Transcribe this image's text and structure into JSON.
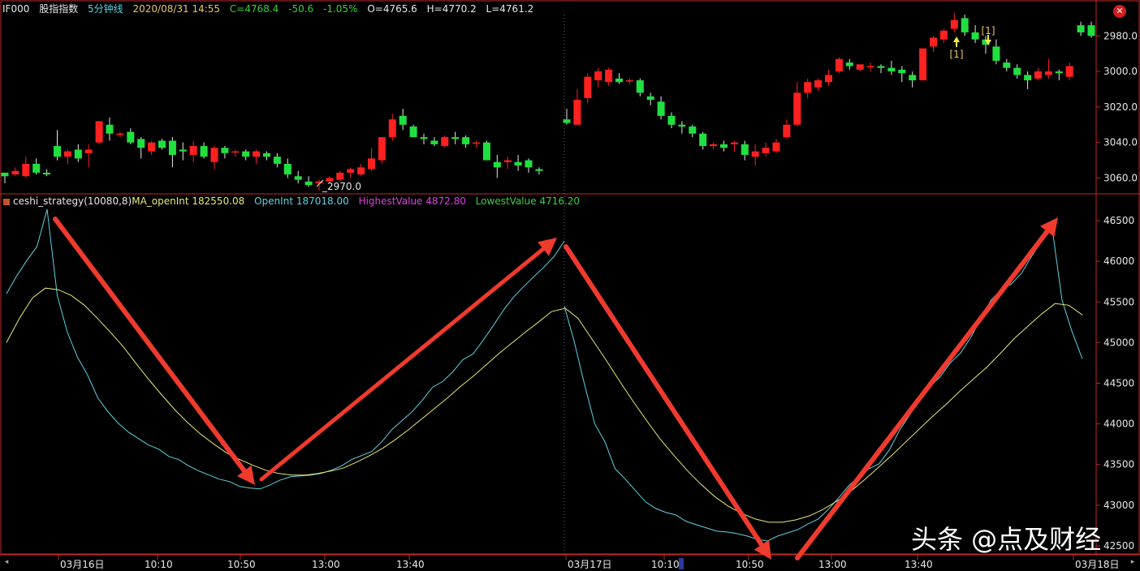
{
  "header": {
    "symbol": "IF000",
    "name": "股指指数",
    "period": "5分钟线",
    "datetime": "2020/08/31 14:55",
    "close": "C=4768.4",
    "change": "-50.6",
    "change_pct": "-1.05%",
    "open": "O=4765.6",
    "high": "H=4770.2",
    "low": "L=4761.2"
  },
  "indicator_header": {
    "name": "ceshi_strategy(10080,8)",
    "ma_label": "MA_openInt 182550.08",
    "oi_label": "OpenInt 187018.00",
    "highest_label": "HighestValue 4872.80",
    "lowest_label": "LowestValue 4716.20"
  },
  "time_axis": [
    "03月16日",
    "10:10",
    "10:50",
    "13:00",
    "13:40",
    "03月17日",
    "10:10",
    "10:50",
    "13:00",
    "13:40",
    "03月18日"
  ],
  "price_ticks": [
    "3060.0",
    "3040.0",
    "3020.0",
    "3000.0",
    "2980.0"
  ],
  "oi_ticks": [
    "46500",
    "46000",
    "45500",
    "45000",
    "44500",
    "44000",
    "43500",
    "43000",
    "42500"
  ],
  "annotations": {
    "low_label": "2970.0",
    "signal_buy": "[1]",
    "signal_sell": "[1]"
  },
  "controls": {
    "close_icon": "✕",
    "scroll_left": "◂",
    "scroll_right": "▸"
  },
  "watermark": "头条 @点及财经",
  "colors": {
    "up": "#ff2020",
    "down": "#20e040",
    "openint": "#5fd3e0",
    "ma": "#e8e878",
    "arrow": "#f03a2e",
    "grid": "#c02828",
    "header_date": "#e8c86a",
    "header_price": "#3ccf3c",
    "highest": "#e040e0",
    "lowest": "#40d040"
  },
  "chart_data": [
    {
      "type": "candlestick",
      "ylim": [
        2972,
        3072
      ],
      "y_ticks": [
        2980,
        3000,
        3020,
        3040,
        3060
      ],
      "sessions": [
        {
          "ohlc": [
            [
              2983,
              2983,
              2977,
              2981
            ],
            [
              2982,
              2986,
              2981,
              2984
            ],
            [
              2981,
              2992,
              2980,
              2988
            ],
            [
              2988,
              2991,
              2982,
              2983
            ],
            [
              2983,
              2985,
              2981,
              2982
            ],
            [
              2998,
              3007,
              2990,
              2992
            ],
            [
              2992,
              2996,
              2988,
              2995
            ],
            [
              2996,
              2999,
              2989,
              2991
            ],
            [
              2994,
              2999,
              2986,
              2996
            ],
            [
              3000,
              3012,
              2999,
              3012
            ],
            [
              3010,
              3014,
              3001,
              3005
            ],
            [
              3005,
              3006,
              3003,
              3005
            ],
            [
              3006,
              3008,
              2999,
              3000
            ],
            [
              3002,
              3003,
              2991,
              2997
            ],
            [
              2995,
              3001,
              2993,
              3000
            ],
            [
              3001,
              3002,
              2996,
              2997
            ],
            [
              3001,
              3003,
              2986,
              2993
            ],
            [
              2996,
              3000,
              2990,
              2995
            ],
            [
              2993,
              3001,
              2989,
              2998
            ],
            [
              2998,
              3000,
              2991,
              2992
            ],
            [
              2989,
              2998,
              2985,
              2997
            ],
            [
              2997,
              2998,
              2991,
              2994
            ],
            [
              2995,
              2996,
              2992,
              2995
            ],
            [
              2995,
              2996,
              2990,
              2992
            ],
            [
              2992,
              2996,
              2988,
              2995
            ],
            [
              2994,
              2995,
              2990,
              2992
            ],
            [
              2992,
              2994,
              2986,
              2988
            ],
            [
              2988,
              2991,
              2980,
              2982
            ],
            [
              2981,
              2984,
              2977,
              2979
            ],
            [
              2978,
              2981,
              2975,
              2976
            ],
            [
              2977,
              2979,
              2973,
              2978
            ],
            [
              2978,
              2981,
              2977,
              2980
            ],
            [
              2979,
              2984,
              2978,
              2983
            ],
            [
              2983,
              2986,
              2980,
              2985
            ],
            [
              2982,
              2988,
              2981,
              2986
            ],
            [
              2985,
              2997,
              2984,
              2991
            ],
            [
              2990,
              3001,
              2988,
              3003
            ],
            [
              3003,
              3016,
              3001,
              3013
            ],
            [
              3015,
              3019,
              3007,
              3010
            ],
            [
              3009,
              3010,
              3003,
              3003
            ],
            [
              3003,
              3005,
              2999,
              3002
            ],
            [
              3001,
              3003,
              2998,
              2999
            ],
            [
              2998,
              3004,
              2997,
              3003
            ],
            [
              3003,
              3006,
              2999,
              3002
            ],
            [
              3003,
              3004,
              2997,
              2999
            ],
            [
              3000,
              3001,
              2997,
              3000
            ],
            [
              3000,
              3001,
              2990,
              2990
            ],
            [
              2989,
              2993,
              2980,
              2986
            ],
            [
              2989,
              2992,
              2985,
              2990
            ],
            [
              2989,
              2993,
              2984,
              2987
            ],
            [
              2990,
              2991,
              2983,
              2986
            ],
            [
              2985,
              2986,
              2982,
              2984
            ]
          ]
        },
        {
          "ohlc": [
            [
              3013,
              3019,
              3010,
              3011
            ],
            [
              3010,
              3030,
              3010,
              3024
            ],
            [
              3025,
              3039,
              3022,
              3037
            ],
            [
              3035,
              3042,
              3031,
              3040
            ],
            [
              3034,
              3042,
              3032,
              3041
            ],
            [
              3036,
              3039,
              3033,
              3034
            ],
            [
              3035,
              3036,
              3033,
              3035
            ],
            [
              3035,
              3036,
              3026,
              3028
            ],
            [
              3026,
              3028,
              3021,
              3024
            ],
            [
              3023,
              3026,
              3013,
              3015
            ],
            [
              3015,
              3017,
              3008,
              3010
            ],
            [
              3010,
              3012,
              3005,
              3009
            ],
            [
              3009,
              3010,
              3003,
              3005
            ],
            [
              3005,
              3006,
              2996,
              2998
            ],
            [
              2998,
              3000,
              2996,
              2999
            ],
            [
              2999,
              3001,
              2995,
              2997
            ],
            [
              2999,
              3001,
              2995,
              3000
            ],
            [
              2999,
              3001,
              2990,
              2993
            ],
            [
              2992,
              2999,
              2987,
              2995
            ],
            [
              2994,
              3000,
              2992,
              2997
            ],
            [
              2995,
              3002,
              2994,
              3000
            ],
            [
              3003,
              3013,
              3002,
              3010
            ],
            [
              3010,
              3034,
              3009,
              3028
            ],
            [
              3028,
              3036,
              3025,
              3034
            ],
            [
              3031,
              3036,
              3029,
              3035
            ],
            [
              3034,
              3041,
              3032,
              3038
            ],
            [
              3040,
              3048,
              3039,
              3047
            ],
            [
              3045,
              3047,
              3041,
              3043
            ],
            [
              3041,
              3044,
              3040,
              3044
            ],
            [
              3043,
              3045,
              3040,
              3043
            ],
            [
              3043,
              3044,
              3039,
              3042
            ],
            [
              3042,
              3046,
              3038,
              3040
            ],
            [
              3041,
              3043,
              3034,
              3039
            ],
            [
              3038,
              3040,
              3031,
              3035
            ],
            [
              3035,
              3041,
              3035,
              3053
            ],
            [
              3054,
              3060,
              3051,
              3059
            ],
            [
              3058,
              3064,
              3056,
              3063
            ],
            [
              3064,
              3073,
              3062,
              3069
            ],
            [
              3070,
              3072,
              3060,
              3062
            ],
            [
              3062,
              3066,
              3056,
              3058
            ],
            [
              3058,
              3060,
              3050,
              3055
            ],
            [
              3054,
              3058,
              3044,
              3046
            ],
            [
              3045,
              3047,
              3040,
              3042
            ],
            [
              3042,
              3044,
              3036,
              3038
            ],
            [
              3038,
              3040,
              3030,
              3035
            ],
            [
              3036,
              3042,
              3035,
              3040
            ],
            [
              3038,
              3047,
              3036,
              3040
            ],
            [
              3040,
              3041,
              3035,
              3039
            ],
            [
              3037,
              3045,
              3035,
              3043
            ],
            [
              3066,
              3068,
              3060,
              3062
            ],
            [
              3066,
              3068,
              3059,
              3060
            ]
          ]
        }
      ]
    },
    {
      "type": "line",
      "ylim": [
        42400,
        46650
      ],
      "y_ticks": [
        42500,
        43000,
        43500,
        44000,
        44500,
        45000,
        45500,
        46000,
        46500
      ],
      "series": [
        {
          "name": "OpenInt",
          "sessions": [
            [
              45600,
              45820,
              46010,
              46180,
              46640,
              45580,
              45130,
              44820,
              44600,
              44320,
              44150,
              44010,
              43900,
              43820,
              43740,
              43690,
              43600,
              43560,
              43480,
              43420,
              43370,
              43320,
              43290,
              43230,
              43210,
              43200,
              43250,
              43310,
              43350,
              43360,
              43370,
              43390,
              43430,
              43480,
              43560,
              43610,
              43660,
              43780,
              43930,
              44040,
              44150,
              44290,
              44450,
              44520,
              44640,
              44790,
              44860,
              45030,
              45210,
              45400,
              45560,
              45690,
              45810,
              45930,
              46060,
              46250
            ],
            [
              45450,
              45000,
              44480,
              44000,
              43780,
              43450,
              43320,
              43180,
              43040,
              42960,
              42910,
              42880,
              42800,
              42760,
              42720,
              42680,
              42670,
              42650,
              42620,
              42580,
              42560,
              42620,
              42660,
              42700,
              42770,
              42830,
              42950,
              43090,
              43240,
              43350,
              43450,
              43510,
              43680,
              43920,
              44110,
              44290,
              44460,
              44580,
              44750,
              44870,
              45060,
              45290,
              45520,
              45650,
              45720,
              45850,
              46060,
              46250,
              46430,
              45520,
              45130,
              44800
            ]
          ]
        },
        {
          "name": "MA_openInt",
          "sessions": [
            [
              45000,
              45300,
              45550,
              45670,
              45650,
              45580,
              45460,
              45300,
              45130,
              44950,
              44740,
              44540,
              44350,
              44170,
              44010,
              43870,
              43750,
              43640,
              43560,
              43490,
              43430,
              43390,
              43370,
              43370,
              43390,
              43420,
              43460,
              43530,
              43610,
              43700,
              43810,
              43930,
              44060,
              44190,
              44320,
              44460,
              44590,
              44730,
              44870,
              45000,
              45130,
              45250,
              45380,
              45420
            ],
            [
              45430,
              45300,
              45050,
              44800,
              44540,
              44290,
              44050,
              43820,
              43620,
              43430,
              43260,
              43110,
              42990,
              42900,
              42830,
              42790,
              42790,
              42820,
              42870,
              42950,
              43050,
              43170,
              43310,
              43460,
              43610,
              43770,
              43930,
              44090,
              44240,
              44400,
              44550,
              44700,
              44870,
              45050,
              45200,
              45350,
              45480,
              45460,
              45340
            ]
          ]
        }
      ]
    }
  ]
}
